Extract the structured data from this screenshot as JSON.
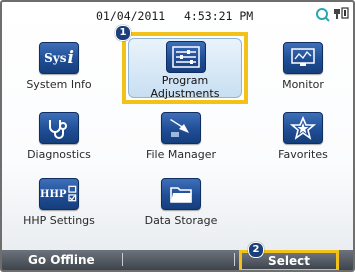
{
  "status": {
    "date": "01/04/2011",
    "time": "4:53:21 PM",
    "usb_icon": "usb-search-icon"
  },
  "tiles": {
    "system_info": {
      "label": "System Info",
      "icon_text": "Sys",
      "icon": "sys-i-icon"
    },
    "program_adjustments": {
      "label_line1": "Program",
      "label_line2": "Adjustments",
      "icon": "sliders-icon",
      "callout": "1"
    },
    "monitor": {
      "label": "Monitor",
      "icon": "monitor-icon"
    },
    "diagnostics": {
      "label": "Diagnostics",
      "icon": "stethoscope-icon"
    },
    "file_manager": {
      "label": "File Manager",
      "icon": "file-transfer-icon"
    },
    "favorites": {
      "label": "Favorites",
      "icon": "star-icon"
    },
    "hhp_settings": {
      "label": "HHP Settings",
      "icon_text": "HHP",
      "icon": "hhp-icon"
    },
    "data_storage": {
      "label": "Data Storage",
      "icon": "folder-icon"
    }
  },
  "bottom_bar": {
    "go_offline": "Go Offline",
    "select": "Select",
    "select_callout": "2"
  },
  "colors": {
    "highlight": "#f3c21a",
    "icon_blue": "#1f4e96",
    "bar": "#4a5058"
  }
}
